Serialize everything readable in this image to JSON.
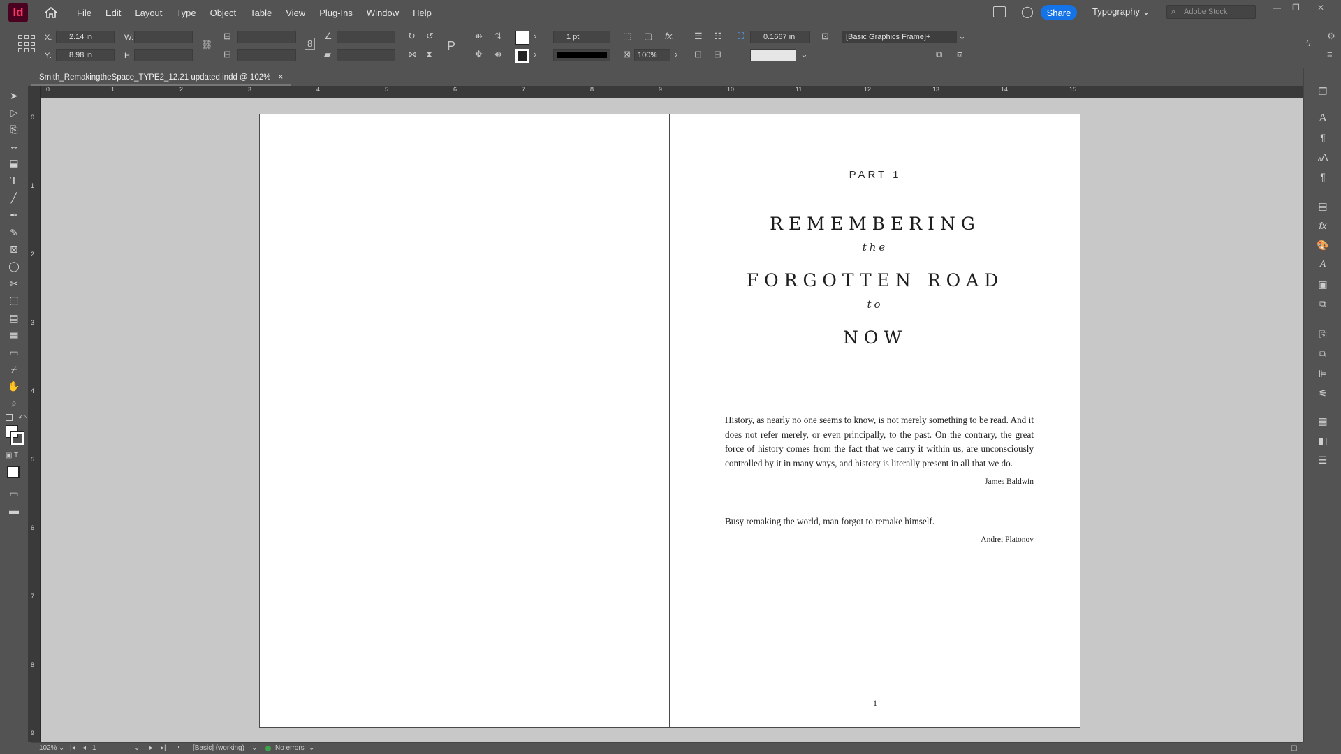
{
  "app": {
    "logo": "Id",
    "accent": "#ff3366"
  },
  "menu": [
    "File",
    "Edit",
    "Layout",
    "Type",
    "Object",
    "Table",
    "View",
    "Plug-Ins",
    "Window",
    "Help"
  ],
  "top_right": {
    "share": "Share",
    "workspace": "Typography",
    "stock_placeholder": "Adobe Stock"
  },
  "control": {
    "x_label": "X:",
    "x_value": "2.14 in",
    "y_label": "Y:",
    "y_value": "8.98 in",
    "w_label": "W:",
    "h_label": "H:",
    "stroke_weight": "1 pt",
    "scale": "100%",
    "corner": "0.1667 in",
    "object_style": "[Basic Graphics Frame]+"
  },
  "document_tab": {
    "title": "Smith_RemakingtheSpace_TYPE2_12.21 updated.indd @ 102%",
    "close": "×"
  },
  "ruler_h": [
    "0",
    "1",
    "2",
    "3",
    "4",
    "5",
    "6",
    "7",
    "8",
    "9",
    "10",
    "11",
    "12",
    "13",
    "14",
    "15"
  ],
  "ruler_v": [
    "0",
    "1",
    "2",
    "3",
    "4",
    "5",
    "6",
    "7",
    "8",
    "9"
  ],
  "page": {
    "part": "PART 1",
    "title_line1": "REMEMBERING",
    "title_line2": "the",
    "title_line3": "FORGOTTEN ROAD",
    "title_line4": "to",
    "title_line5": "NOW",
    "quote1": "History, as nearly no one seems to know, is not merely something to be read. And it does not refer merely, or even principally, to the past. On the contrary, the great force of history comes from the fact that we carry it within us, are unconsciously controlled by it in many ways, and history is literally present in all that we do.",
    "attr1": "—James Baldwin",
    "quote2": "Busy remaking the world, man forgot to remake himself.",
    "attr2": "—Andrei Platonov",
    "page_number": "1"
  },
  "status": {
    "zoom": "102%",
    "page": "1",
    "profile": "[Basic] (working)",
    "errors": "No errors"
  }
}
